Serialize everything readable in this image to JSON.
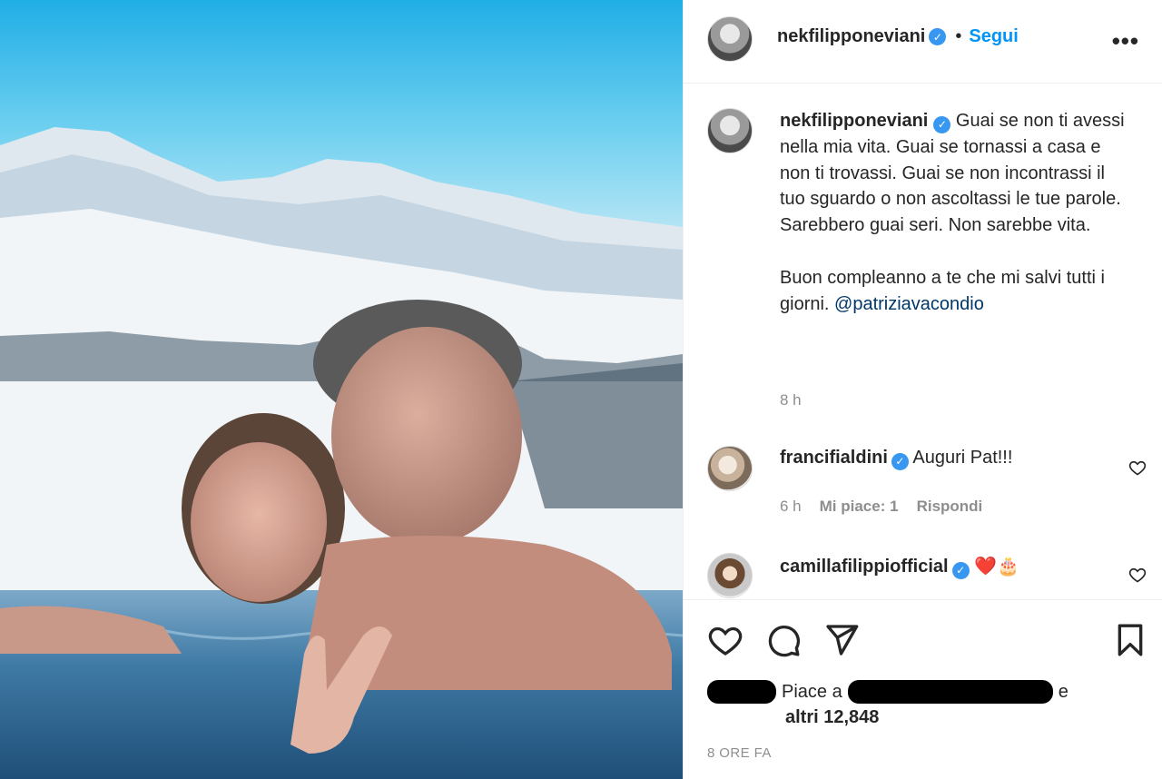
{
  "post": {
    "author": "nekfilipponeviani",
    "follow_label": "Segui",
    "separator": "•",
    "more_label": "•••",
    "caption": "Guai se non ti avessi nella mia vita. Guai se tornassi a casa e non ti trovassi. Guai se non incontrassi il tuo sguardo o non ascoltassi le tue parole. Sarebbero guai seri. Non sarebbe vita.\n\nBuon compleanno a te che mi salvi tutti i giorni. ",
    "mention": "@patriziavacondio",
    "caption_time": "8 h"
  },
  "comments": [
    {
      "username": "francifialdini",
      "text": "Auguri Pat!!!",
      "time": "6 h",
      "likes": "Mi piace: 1",
      "reply": "Rispondi"
    },
    {
      "username": "camillafilippiofficial",
      "text": "❤️🎂"
    }
  ],
  "actions": {
    "like_icon": "heart-icon",
    "comment_icon": "comment-icon",
    "share_icon": "paper-plane-icon",
    "save_icon": "bookmark-icon"
  },
  "likes": {
    "prefix": "Piace a",
    "conjunction": "e",
    "others": "altri 12,848"
  },
  "time_ago": "8 ORE FA",
  "colors": {
    "accent": "#0095f6",
    "verified": "#3897f0",
    "mention": "#00376b",
    "muted": "#8e8e8e"
  }
}
